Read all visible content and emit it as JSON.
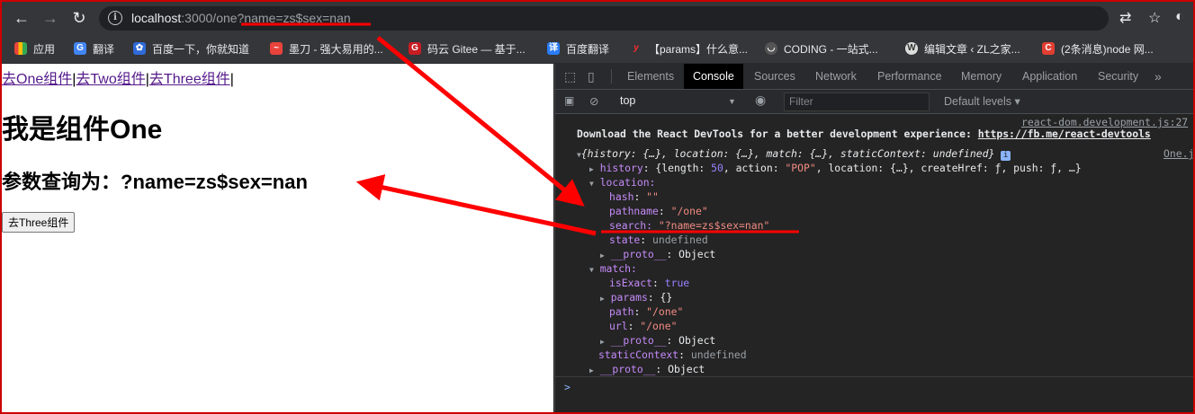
{
  "browser": {
    "url_host": "localhost",
    "url_rest": ":3000/one?name=zs$sex=nan",
    "bookmarks": [
      {
        "label": "应用",
        "color": "#e8453c"
      },
      {
        "label": "翻译",
        "color": "#4285f4"
      },
      {
        "label": "百度一下，你就知道",
        "color": "#2f6bd8"
      },
      {
        "label": "墨刀 - 强大易用的...",
        "color": "#e9433b"
      },
      {
        "label": "码云 Gitee — 基于...",
        "color": "#c71d23"
      },
      {
        "label": "百度翻译",
        "color": "#2a7cf6"
      },
      {
        "label": "【params】什么意...",
        "color": "#ff2b2b"
      },
      {
        "label": "CODING - 一站式...",
        "color": "#333333"
      },
      {
        "label": "编辑文章 ‹ ZL之家...",
        "color": "#dddddd"
      },
      {
        "label": "(2条消息)node 网...",
        "color": "#e33e33"
      }
    ]
  },
  "page": {
    "links": [
      "去One组件",
      "去Two组件",
      "去Three组件"
    ],
    "separator": "|",
    "heading": "我是组件One",
    "query_line": "参数查询为：?name=zs$sex=nan",
    "button_label": "去Three组件"
  },
  "devtools": {
    "tabs": [
      "Elements",
      "Console",
      "Sources",
      "Network",
      "Performance",
      "Memory",
      "Application",
      "Security"
    ],
    "active_tab": "Console",
    "context": "top",
    "filter_placeholder": "Filter",
    "levels": "Default levels",
    "console": {
      "source_file": "react-dom.development.js:27",
      "message": "Download the React DevTools for a better development experience: ",
      "message_link": "https://fb.me/react-devtools",
      "object_summary": "{history: {…}, location: {…}, match: {…}, staticContext: undefined}",
      "object_source": "One.j",
      "history_line": "history: {length: 50, action: \"POP\", location: {…}, createHref: ƒ, push: ƒ, …}",
      "location_key": "location:",
      "hash": "hash: \"\"",
      "pathname": "pathname: \"/one\"",
      "search_key": "search: ",
      "search_value": "\"?name=zs$sex=nan\"",
      "state": "state: undefined",
      "proto": "__proto__: Object",
      "match_key": "match:",
      "isExact": "isExact: true",
      "params": "params: {}",
      "path": "path: \"/one\"",
      "url": "url: \"/one\"",
      "staticContext": "staticContext: undefined",
      "prompt": ">"
    }
  },
  "colors": {
    "annotation": "#ff0000",
    "link": "#551a8b",
    "string": "#f28b82",
    "key": "#9ca3ff"
  }
}
